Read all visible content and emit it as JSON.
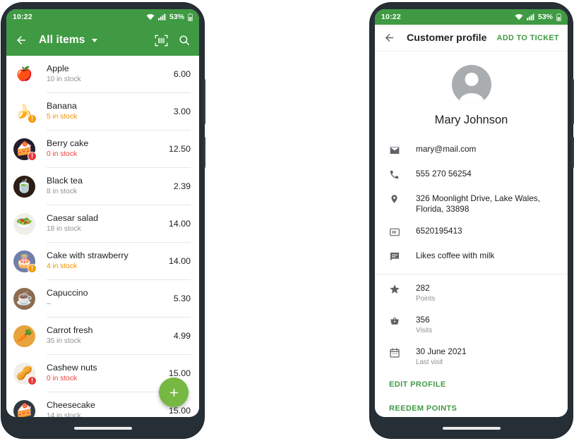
{
  "left_phone": {
    "status_bar": {
      "time": "10:22",
      "battery_pct": "53%",
      "wifi_icon": "wifi-icon",
      "signal_icon": "signal-icon",
      "battery_icon": "battery-icon"
    },
    "app_bar": {
      "back_icon": "back-arrow-icon",
      "title": "All items",
      "dropdown_icon": "chevron-down-icon",
      "barcode_icon": "barcode-scan-icon",
      "search_icon": "search-icon"
    },
    "items": [
      {
        "name": "Apple",
        "stock": "10 in stock",
        "price": "6.00",
        "state": "ok",
        "emoji": "🍎",
        "bg": "#ffffff"
      },
      {
        "name": "Banana",
        "stock": "5 in stock",
        "price": "3.00",
        "state": "warn",
        "emoji": "🍌",
        "bg": "#ffffff"
      },
      {
        "name": "Berry cake",
        "stock": "0 in stock",
        "price": "12.50",
        "state": "err",
        "emoji": "🍰",
        "bg": "#241d2b"
      },
      {
        "name": "Black tea",
        "stock": "8  in stock",
        "price": "2.39",
        "state": "ok",
        "emoji": "🍵",
        "bg": "#2b1d14"
      },
      {
        "name": "Caesar salad",
        "stock": "18 in stock",
        "price": "14.00",
        "state": "ok",
        "emoji": "🥗",
        "bg": "#f0efe9"
      },
      {
        "name": "Cake with strawberry",
        "stock": "4 in stock",
        "price": "14.00",
        "state": "warn",
        "emoji": "🎂",
        "bg": "#6f7fa8"
      },
      {
        "name": "Capuccino",
        "stock": "–",
        "price": "5.30",
        "state": "ok",
        "emoji": "☕",
        "bg": "#8c6b4f"
      },
      {
        "name": "Carrot fresh",
        "stock": "35 in stock",
        "price": "4.99",
        "state": "ok",
        "emoji": "🥕",
        "bg": "#e8a33c"
      },
      {
        "name": "Cashew nuts",
        "stock": "0 in stock",
        "price": "15.00",
        "state": "err",
        "emoji": "🥜",
        "bg": "#f2efe8"
      },
      {
        "name": "Cheesecake",
        "stock": "14 in stock",
        "price": "15.00",
        "state": "ok",
        "emoji": "🍰",
        "bg": "#2f3a44"
      }
    ],
    "fab": {
      "icon": "plus-icon",
      "label": "+"
    },
    "badge_glyph": "!"
  },
  "right_phone": {
    "status_bar": {
      "time": "10:22",
      "battery_pct": "53%",
      "wifi_icon": "wifi-icon",
      "signal_icon": "signal-icon",
      "battery_icon": "battery-icon"
    },
    "app_bar": {
      "back_icon": "back-arrow-icon",
      "title": "Customer profile",
      "action_label": "ADD TO TICKET"
    },
    "customer": {
      "avatar_icon": "person-avatar-icon",
      "name": "Mary Johnson",
      "contacts": [
        {
          "icon": "email-icon",
          "value": "mary@mail.com"
        },
        {
          "icon": "phone-icon",
          "value": "555 270 56254"
        },
        {
          "icon": "location-icon",
          "value": "326  Moonlight Drive, Lake Wales, Florida, 33898"
        },
        {
          "icon": "card-icon",
          "value": "6520195413"
        },
        {
          "icon": "note-icon",
          "value": "Likes coffee with milk"
        }
      ],
      "stats": [
        {
          "icon": "star-icon",
          "value": "282",
          "label": "Points"
        },
        {
          "icon": "basket-icon",
          "value": "356",
          "label": "Visits"
        },
        {
          "icon": "calendar-icon",
          "value": "30 June 2021",
          "label": "Last visit"
        }
      ],
      "actions": [
        {
          "label": "EDIT PROFILE"
        },
        {
          "label": "REEDEM POINTS"
        }
      ]
    }
  },
  "colors": {
    "brand_green": "#3f9a43",
    "fab_green": "#76b843",
    "warn_orange": "#f09200",
    "error_red": "#e8433a"
  }
}
